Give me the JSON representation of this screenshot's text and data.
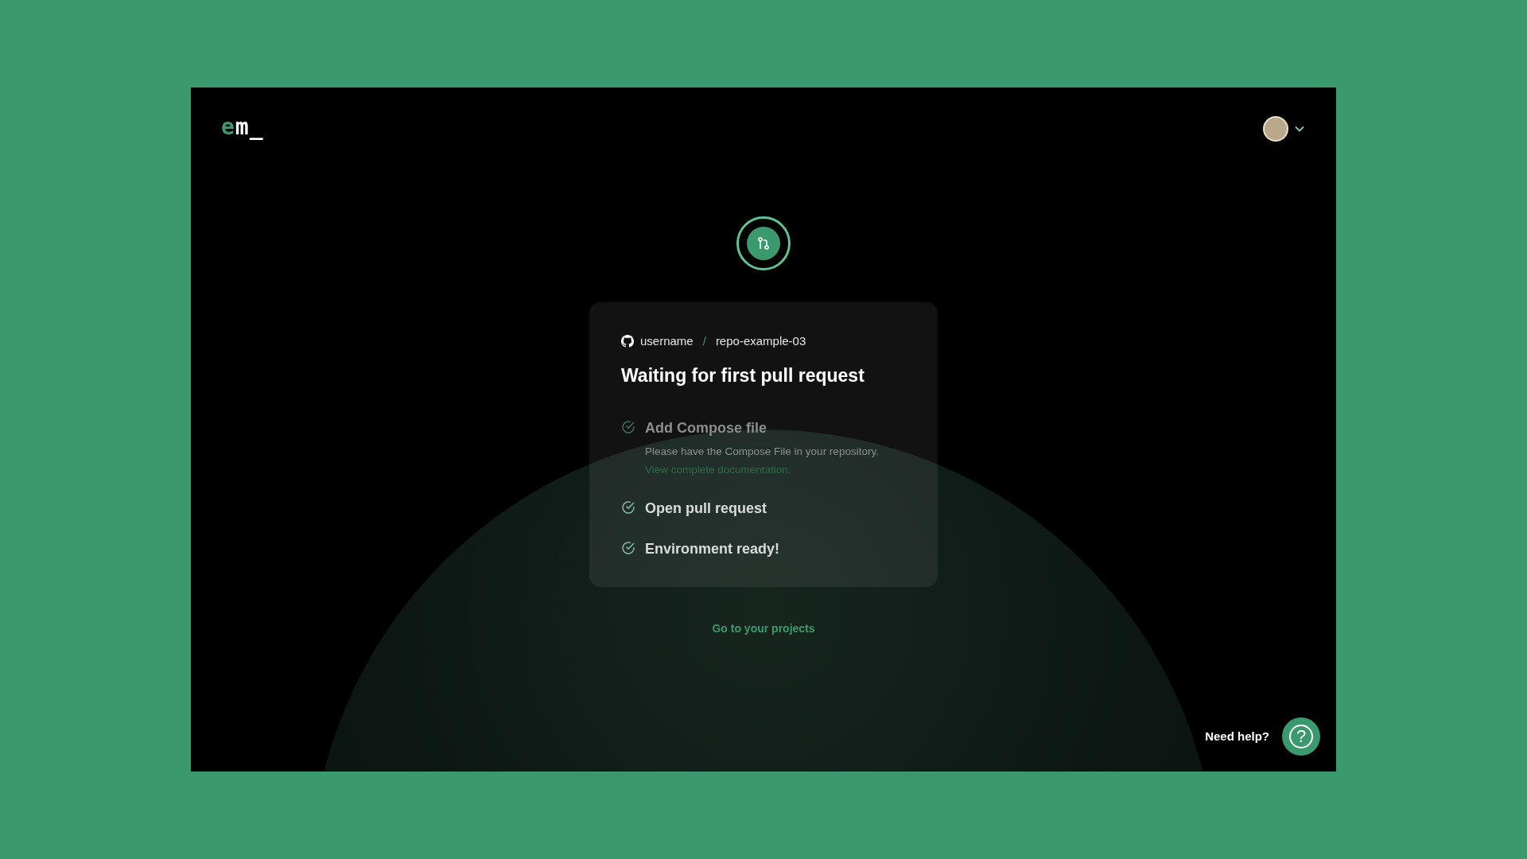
{
  "logo": {
    "accent": "e",
    "rest": "m_"
  },
  "repo": {
    "owner": "username",
    "separator": "/",
    "name": "repo-example-03"
  },
  "title": "Waiting for first pull request",
  "steps": [
    {
      "title": "Add Compose file",
      "description": "Please have the Compose File in your repository.",
      "link": "View complete documentation.",
      "current": false
    },
    {
      "title": "Open pull request",
      "current": true
    },
    {
      "title": "Environment ready!",
      "current": true
    }
  ],
  "projects_link": "Go to your projects",
  "help": {
    "label": "Need help?",
    "icon": "?"
  }
}
